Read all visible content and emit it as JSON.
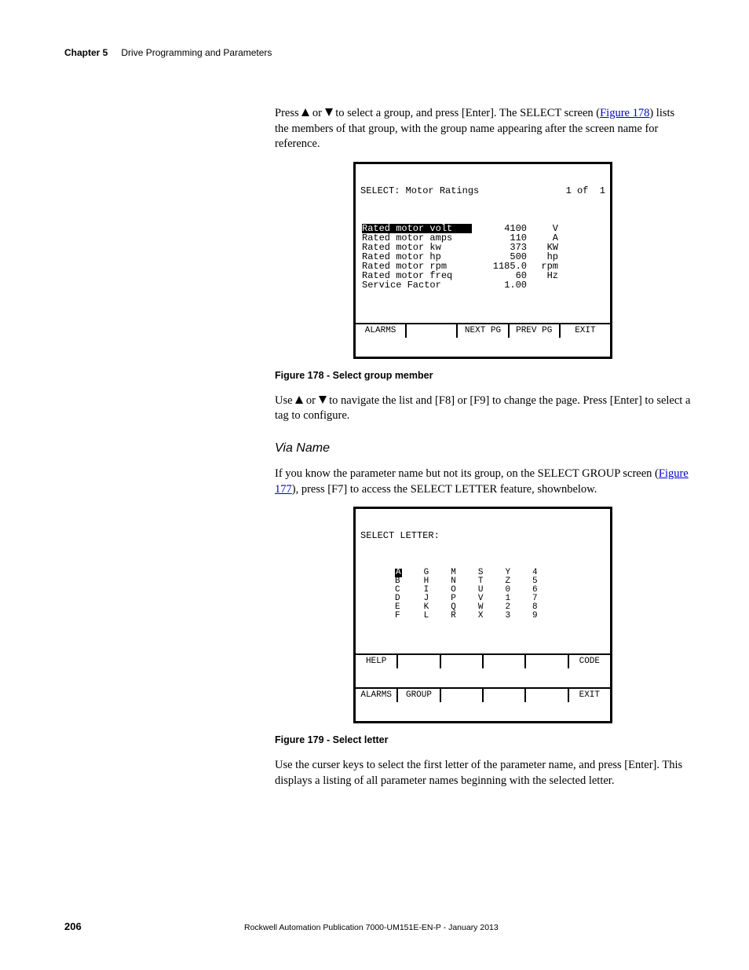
{
  "header": {
    "chapter": "Chapter 5",
    "title": "Drive Programming and Parameters"
  },
  "p1a": "Press ",
  "p1b": " or ",
  "p1c": " to select a group, and press [Enter]. The SELECT screen (",
  "p1_link": "Figure 178",
  "p1d": ") lists the members of that group, with the group name appearing after the screen name for reference.",
  "lcd1": {
    "title_left": "SELECT: Motor Ratings",
    "title_right": "1 of  1",
    "rows": [
      {
        "label": "Rated motor volt",
        "val": "4100",
        "unit": "V",
        "sel": true
      },
      {
        "label": "Rated motor amps",
        "val": "110",
        "unit": "A"
      },
      {
        "label": "Rated motor kw",
        "val": "373",
        "unit": "KW"
      },
      {
        "label": "Rated motor hp",
        "val": "500",
        "unit": "hp"
      },
      {
        "label": "Rated motor rpm",
        "val": "1185.0",
        "unit": "rpm"
      },
      {
        "label": "Rated motor freq",
        "val": "60",
        "unit": "Hz"
      },
      {
        "label": "Service Factor",
        "val": "1.00",
        "unit": ""
      }
    ],
    "buttons": [
      "ALARMS",
      "",
      "NEXT PG",
      "PREV PG",
      "EXIT"
    ]
  },
  "fig178": "Figure 178 - Select group member",
  "p2a": "Use ",
  "p2b": " or ",
  "p2c": " to navigate the list and [F8] or [F9] to change the page. Press [Enter] to select a tag to configure.",
  "subhead": "Via Name",
  "p3a": "If you know the parameter name but not its group, on the SELECT GROUP screen (",
  "p3_link": "Figure 177",
  "p3b": "), press [F7] to access the SELECT LETTER feature, shownbelow.",
  "lcd2": {
    "title": "SELECT LETTER:",
    "cols": [
      [
        "A",
        "B",
        "C",
        "D",
        "E",
        "F"
      ],
      [
        "G",
        "H",
        "I",
        "J",
        "K",
        "L"
      ],
      [
        "M",
        "N",
        "O",
        "P",
        "Q",
        "R"
      ],
      [
        "S",
        "T",
        "U",
        "V",
        "W",
        "X"
      ],
      [
        "Y",
        "Z",
        "0",
        "1",
        "2",
        "3"
      ],
      [
        "4",
        "5",
        "6",
        "7",
        "8",
        "9"
      ]
    ],
    "sel_col": 0,
    "sel_row": 0,
    "buttons_top": [
      "HELP",
      "",
      "",
      "",
      "",
      "CODE"
    ],
    "buttons_bot": [
      "ALARMS",
      "GROUP",
      "",
      "",
      "",
      "EXIT"
    ]
  },
  "fig179": "Figure 179 - Select letter",
  "p4": "Use the curser keys to select the first letter of the parameter name, and press [Enter]. This displays a listing of all parameter names beginning with the selected letter.",
  "footer": {
    "page": "206",
    "pub": "Rockwell Automation Publication 7000-UM151E-EN-P - January 2013"
  }
}
